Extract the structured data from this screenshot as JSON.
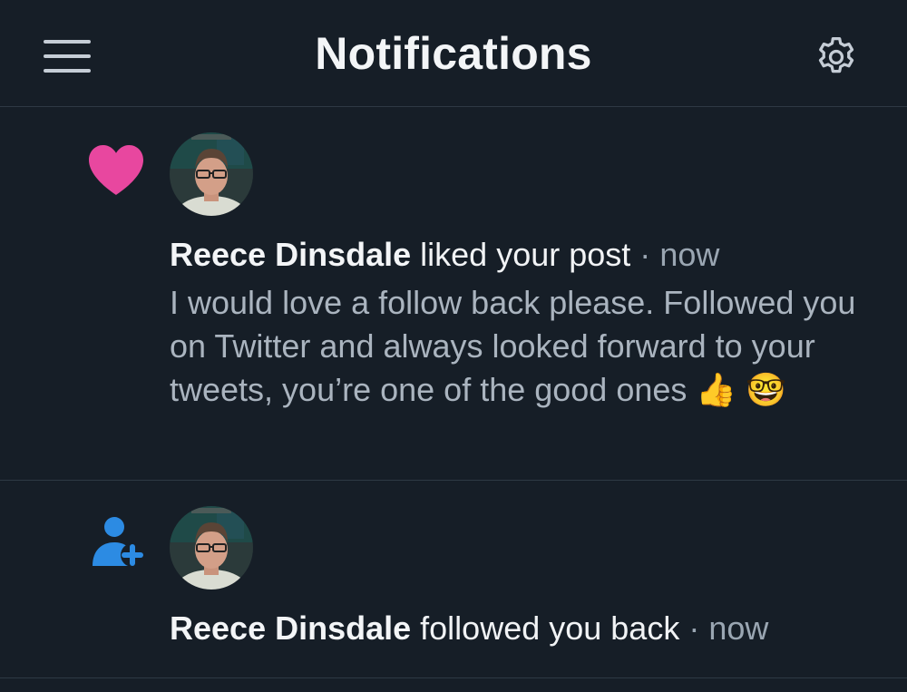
{
  "header": {
    "title": "Notifications"
  },
  "notifications": [
    {
      "type": "like",
      "icon": "heart-icon",
      "icon_color": "#e8479f",
      "user": "Reece Dinsdale",
      "action": "liked your post",
      "separator": "·",
      "time": "now",
      "post_text": "I would love a follow back please. Followed you on Twitter and always looked forward to your tweets, you’re one of the good ones 👍 🤓"
    },
    {
      "type": "follow",
      "icon": "person-add-icon",
      "icon_color": "#2c8be3",
      "user": "Reece Dinsdale",
      "action": "followed you back",
      "separator": "·",
      "time": "now"
    }
  ],
  "colors": {
    "background": "#161e27",
    "divider": "#2e3944",
    "primary_text": "#f3f5f7",
    "secondary_text": "#9aa6b2"
  }
}
